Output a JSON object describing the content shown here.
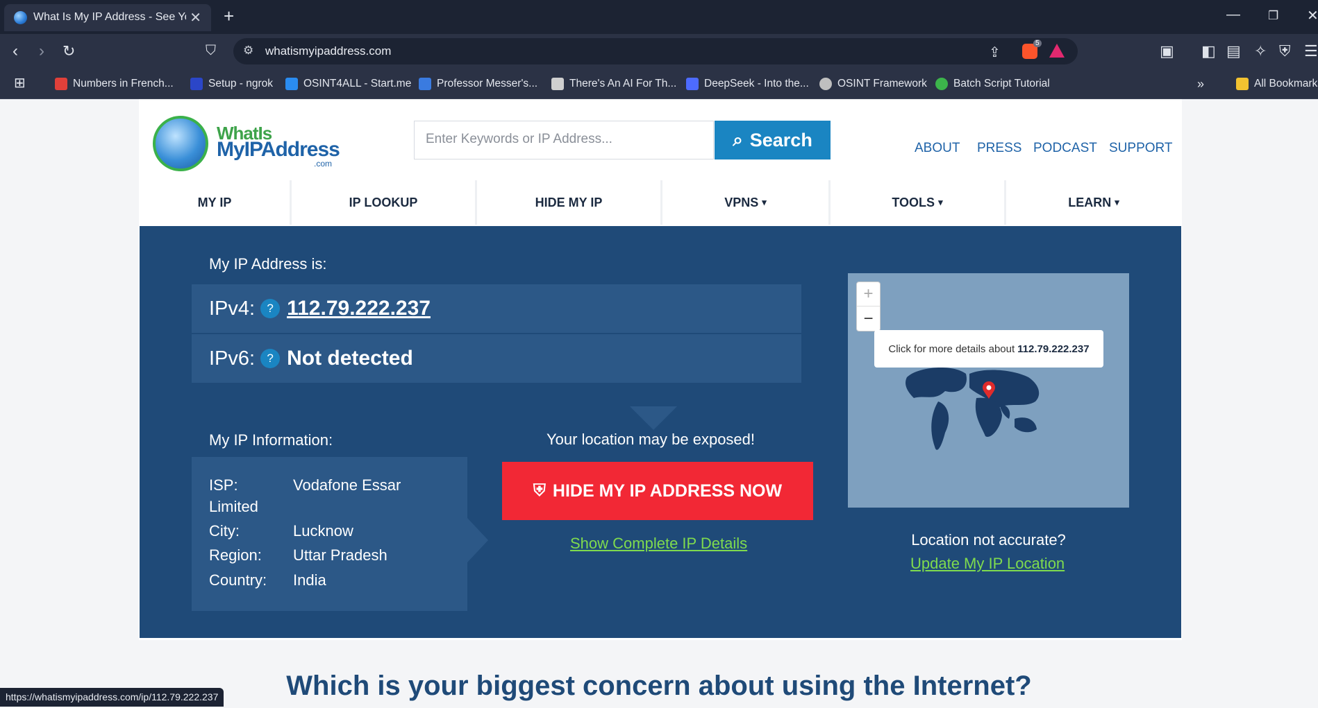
{
  "browser": {
    "tab_title": "What Is My IP Address - See Your",
    "url": "whatismyipaddress.com",
    "status_url": "https://whatismyipaddress.com/ip/112.79.222.237",
    "brave_badge": "5",
    "bookmarks": [
      {
        "label": "Numbers in French...",
        "color": "#e0403a"
      },
      {
        "label": "Setup - ngrok",
        "color": "#2b46c8"
      },
      {
        "label": "OSINT4ALL - Start.me",
        "color": "#2a8cf0"
      },
      {
        "label": "Professor Messer's...",
        "color": "#3a7be0"
      },
      {
        "label": "There's An AI For Th...",
        "color": "#cfcfcf"
      },
      {
        "label": "DeepSeek - Into the...",
        "color": "#4d6bfe"
      },
      {
        "label": "OSINT Framework",
        "color": "#bfbfbf"
      },
      {
        "label": "Batch Script Tutorial",
        "color": "#3cb44b"
      }
    ],
    "all_bookmarks": "All Bookmarks"
  },
  "site": {
    "logo_line1": "WhatIs",
    "logo_line2": "MyIPAddress",
    "logo_line3": ".com",
    "search_placeholder": "Enter Keywords or IP Address...",
    "search_button": "Search",
    "top_links": [
      "ABOUT",
      "PRESS",
      "PODCAST",
      "SUPPORT"
    ],
    "nav": [
      {
        "label": "MY IP",
        "caret": ""
      },
      {
        "label": "IP LOOKUP",
        "caret": ""
      },
      {
        "label": "HIDE MY IP",
        "caret": ""
      },
      {
        "label": "VPNS",
        "caret": "▾"
      },
      {
        "label": "TOOLS",
        "caret": "▾"
      },
      {
        "label": "LEARN",
        "caret": "▾"
      }
    ]
  },
  "hero": {
    "ip_heading": "My IP Address is:",
    "ipv4_label": "IPv4:",
    "ipv4_value": "112.79.222.237",
    "ipv6_label": "IPv6:",
    "ipv6_value": "Not detected",
    "info_heading": "My IP Information:",
    "info": [
      {
        "key": "ISP:",
        "value": "Vodafone Essar"
      },
      {
        "key": "Limited",
        "value": ""
      },
      {
        "key": "City:",
        "value": "Lucknow"
      },
      {
        "key": "Region:",
        "value": "Uttar Pradesh"
      },
      {
        "key": "Country:",
        "value": "India"
      }
    ],
    "exposed": "Your location may be exposed!",
    "hide_button": "HIDE MY IP ADDRESS NOW",
    "complete_details": "Show Complete IP Details",
    "map_tooltip_prefix": "Click for more details about",
    "map_tooltip_ip": "112.79.222.237",
    "not_accurate": "Location not accurate?",
    "update_location": "Update My IP Location"
  },
  "concern_heading": "Which is your biggest concern about using the Internet?"
}
